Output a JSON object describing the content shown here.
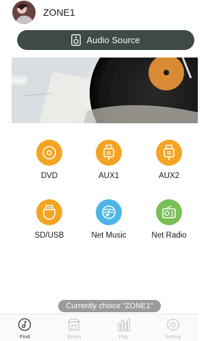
{
  "header": {
    "zone_title": "ZONE1"
  },
  "audio_source": {
    "label": "Audio Source",
    "icon": "speaker-icon"
  },
  "sources": [
    {
      "label": "DVD",
      "icon": "disc-icon",
      "color": "#f4a423"
    },
    {
      "label": "AUX1",
      "icon": "aux-plug-icon",
      "color": "#f4a423"
    },
    {
      "label": "AUX2",
      "icon": "aux-plug-icon",
      "color": "#f4a423"
    },
    {
      "label": "SD/USB",
      "icon": "usb-icon",
      "color": "#f4a423"
    },
    {
      "label": "Net Music",
      "icon": "net-music-icon",
      "color": "#4db5e8"
    },
    {
      "label": "Net Radio",
      "icon": "radio-icon",
      "color": "#79bf57"
    }
  ],
  "toast": {
    "text": "Currently choice \"ZONE1\""
  },
  "tabs": [
    {
      "label": "Find",
      "icon": "music-note-icon",
      "active": true
    },
    {
      "label": "Room",
      "icon": "room-icon",
      "active": false
    },
    {
      "label": "Play",
      "icon": "equalizer-icon",
      "active": false
    },
    {
      "label": "Setting",
      "icon": "gear-icon",
      "active": false
    }
  ],
  "colors": {
    "accent_orange": "#f4a423",
    "accent_blue": "#4db5e8",
    "accent_green": "#79bf57",
    "button_dark": "#3f4a48"
  }
}
